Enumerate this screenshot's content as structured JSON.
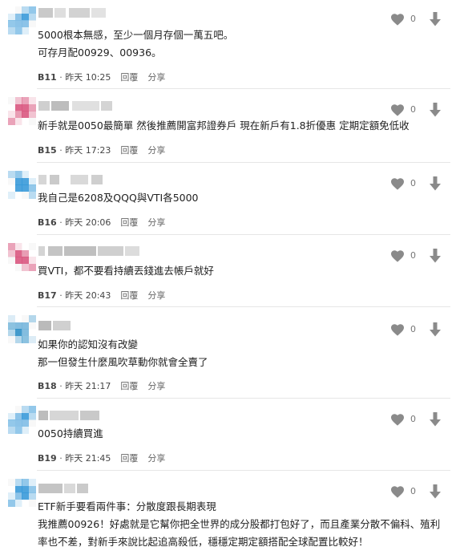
{
  "comments": [
    {
      "floor": "B11",
      "time": "昨天 10:25",
      "lines": [
        "5000根本無感，至少一個月存個一萬五吧。",
        "可存月配00929、00936。"
      ],
      "likes": "0",
      "avatar_color": "#3a9ad9"
    },
    {
      "floor": "B15",
      "time": "昨天 17:23",
      "lines": [
        "新手就是0050最簡單 然後推薦開富邦證券戶 現在新戶有1.8折優惠 定期定額免低收"
      ],
      "likes": "0",
      "avatar_color": "#d9577f"
    },
    {
      "floor": "B16",
      "time": "昨天 20:06",
      "lines": [
        "我自己是6208及QQQ與VTI各5000"
      ],
      "likes": "0",
      "avatar_color": "#3a9ad9"
    },
    {
      "floor": "B17",
      "time": "昨天 20:43",
      "lines": [
        "買VTI，都不要看持續丟錢進去帳戶就好"
      ],
      "likes": "0",
      "avatar_color": "#d9577f"
    },
    {
      "floor": "B18",
      "time": "昨天 21:17",
      "lines": [
        "如果你的認知沒有改變",
        "那一但發生什麼風吹草動你就會全賣了"
      ],
      "likes": "0",
      "avatar_color": "#2e8fc7"
    },
    {
      "floor": "B19",
      "time": "昨天 21:45",
      "lines": [
        "0050持續買進"
      ],
      "likes": "0",
      "avatar_color": "#3a9ad9"
    },
    {
      "floor": "",
      "time": "",
      "lines": [
        "ETF新手要看兩件事：分散度跟長期表現",
        "我推薦00926！好處就是它幫你把全世界的成分股都打包好了，而且產業分散不偏科、殖利",
        "率也不差，對新手來說比起追高殺低，穩穩定期定額搭配全球配置比較好！"
      ],
      "likes": "0",
      "avatar_color": "#3a9ad9"
    }
  ],
  "actions": {
    "reply": "回覆",
    "share": "分享"
  },
  "colors": {
    "icon_gray": "#8a8a8a",
    "divider": "#e6e6e6"
  },
  "icons": {
    "like": "heart-icon",
    "dislike": "arrow-down-icon"
  }
}
